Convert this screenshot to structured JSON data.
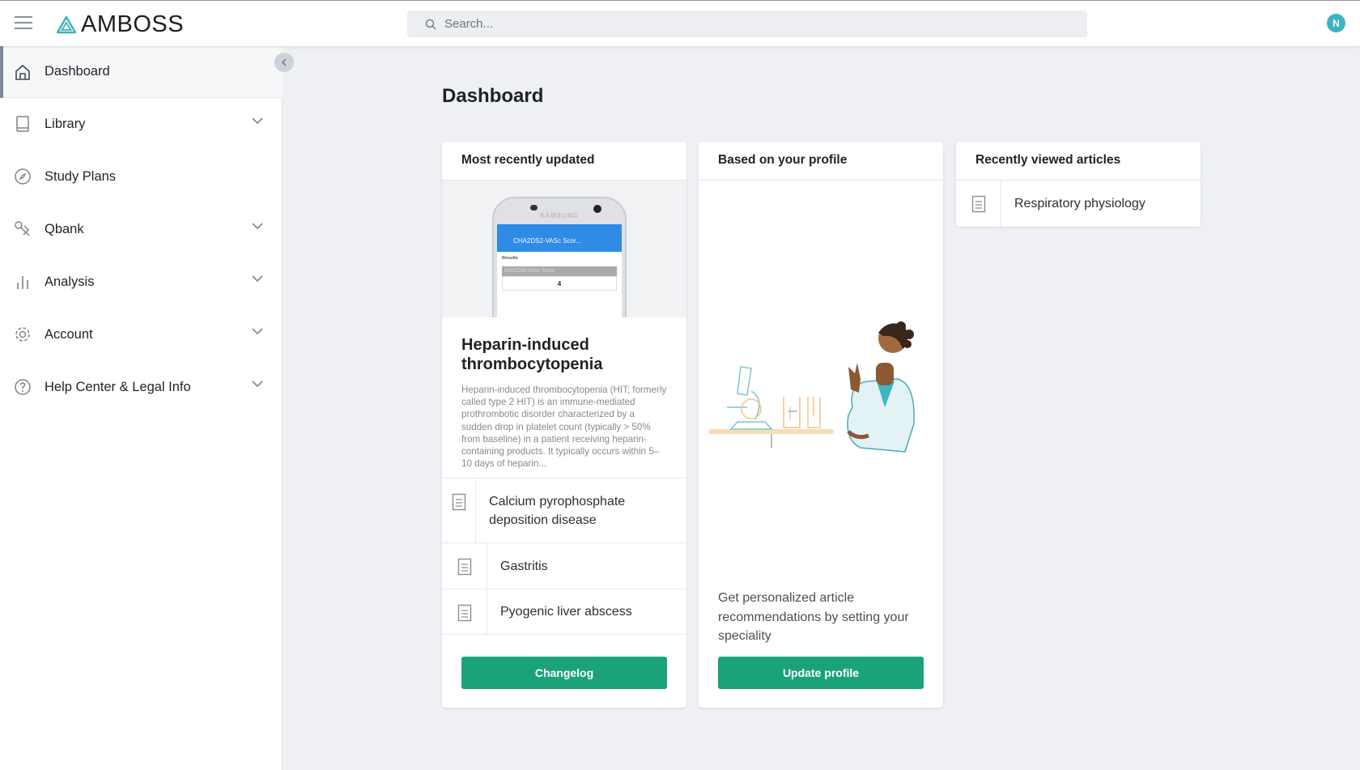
{
  "header": {
    "logo": "AMBOSS",
    "search_placeholder": "Search...",
    "avatar_initial": "N"
  },
  "sidebar": {
    "items": [
      {
        "label": "Dashboard",
        "icon": "home-icon",
        "expandable": false,
        "active": true
      },
      {
        "label": "Library",
        "icon": "book-icon",
        "expandable": true
      },
      {
        "label": "Study Plans",
        "icon": "compass-icon",
        "expandable": false
      },
      {
        "label": "Qbank",
        "icon": "pen-icon",
        "expandable": true
      },
      {
        "label": "Analysis",
        "icon": "bar-chart-icon",
        "expandable": true
      },
      {
        "label": "Account",
        "icon": "gear-icon",
        "expandable": true
      },
      {
        "label": "Help Center & Legal Info",
        "icon": "help-icon",
        "expandable": true
      }
    ]
  },
  "main": {
    "title": "Dashboard",
    "recent_updated": {
      "header": "Most recently updated",
      "image": {
        "brand": "SAMSUNG",
        "app_title": "CHA2DS2-VASc Scor...",
        "results_label": "Results",
        "score_label": "CHA2DS2-VASc Score",
        "score_value": "4"
      },
      "article_title": "Heparin-induced thrombocytopenia",
      "article_desc": "Heparin-induced thrombocytopenia (HIT; formerly called type 2 HIT) is an immune-mediated prothrombotic disorder characterized by a sudden drop in platelet count (typically > 50% from baseline) in a patient receiving heparin-containing products. It typically occurs within 5–10 days of heparin...",
      "items": [
        "Calcium pyrophosphate deposition disease",
        "Gastritis",
        "Pyogenic liver abscess"
      ],
      "button": "Changelog"
    },
    "profile": {
      "header": "Based on your profile",
      "text": "Get personalized article recommendations by setting your speciality",
      "button": "Update profile"
    },
    "recent_viewed": {
      "header": "Recently viewed articles",
      "items": [
        "Respiratory physiology"
      ]
    }
  },
  "colors": {
    "accent": "#1aa37a",
    "avatar": "#3bb3c3",
    "logo": "#3bb3b8"
  }
}
